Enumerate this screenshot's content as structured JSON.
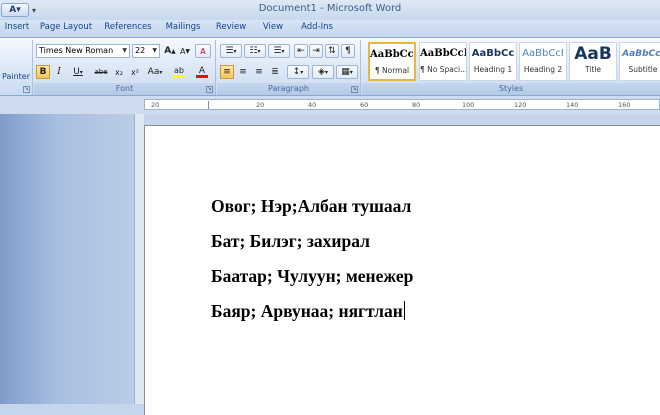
{
  "title_bar": {
    "title": "Document1 - Microsoft Word",
    "qat_undo": "A",
    "qat_more": "▾"
  },
  "tabs": [
    "Insert",
    "Page Layout",
    "References",
    "Mailings",
    "Review",
    "View",
    "Add-Ins"
  ],
  "clipboard": {
    "painter_label": "Painter"
  },
  "font": {
    "group_label": "Font",
    "font_name": "Times New Roman",
    "font_size": "22",
    "grow": "A",
    "shrink": "A",
    "clear": "A",
    "bold": "B",
    "italic": "I",
    "underline": "U",
    "strike": "abe",
    "subscript": "x₂",
    "superscript": "x²",
    "change_case": "Aa",
    "highlight": "ab",
    "font_color": "A",
    "active_bold": true,
    "colors": {
      "highlight": "#ffff00",
      "font_color": "#e01010"
    }
  },
  "paragraph": {
    "group_label": "Paragraph",
    "show_marks": "¶"
  },
  "styles": {
    "group_label": "Styles",
    "items": [
      {
        "preview": "AaBbCcI",
        "name": "¶ Normal",
        "selected": true
      },
      {
        "preview": "AaBbCcI",
        "name": "¶ No Spaci..."
      },
      {
        "preview": "AaBbCc",
        "name": "Heading 1"
      },
      {
        "preview": "AaBbCcI",
        "name": "Heading 2"
      },
      {
        "preview": "AaB",
        "name": "Title"
      },
      {
        "preview": "AaBbCcI",
        "name": "Subtitle"
      }
    ]
  },
  "ruler": {
    "ticks": [
      "20",
      "20",
      "40",
      "60",
      "80",
      "100",
      "120",
      "140",
      "160"
    ]
  },
  "document": {
    "lines": [
      "Овог; Нэр;Албан тушаал",
      "Бат; Билэг; захирал",
      "Баатар; Чулуун; менежер",
      "Баяр; Арвунаа; нягтлан"
    ]
  }
}
